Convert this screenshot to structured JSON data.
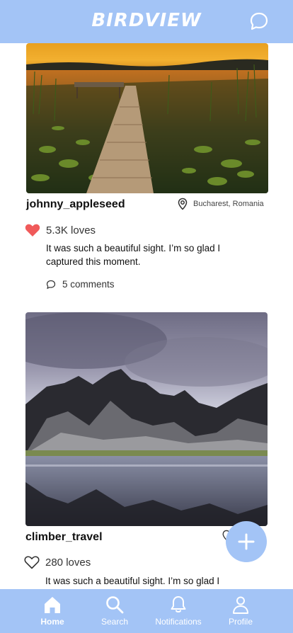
{
  "app": {
    "title": "BIRDVIEW"
  },
  "header": {
    "icons": [
      "chat-bubble-icon"
    ]
  },
  "posts": [
    {
      "username": "johnny_appleseed",
      "location": "Bucharest, Romania",
      "loves": "5.3K loves",
      "loved": true,
      "caption": "It was such a beautiful sight. I’m so glad I captured this moment.",
      "comments": "5 comments",
      "image": "sunset-lake-dock"
    },
    {
      "username": "climber_travel",
      "location": "",
      "loves": "280 loves",
      "loved": false,
      "caption": "It was such a beautiful sight. I’m so glad I captured this moment.",
      "comments": "",
      "image": "mountain-reflection"
    }
  ],
  "fab": {
    "icon": "plus-icon"
  },
  "tabbar": {
    "tabs": [
      {
        "label": "Home",
        "icon": "home-icon",
        "active": true
      },
      {
        "label": "Search",
        "icon": "search-icon",
        "active": false
      },
      {
        "label": "Notifications",
        "icon": "bell-icon",
        "active": false
      },
      {
        "label": "Profile",
        "icon": "person-icon",
        "active": false
      }
    ]
  },
  "colors": {
    "accent": "#a3c4f6",
    "heart": "#f05a5a"
  }
}
